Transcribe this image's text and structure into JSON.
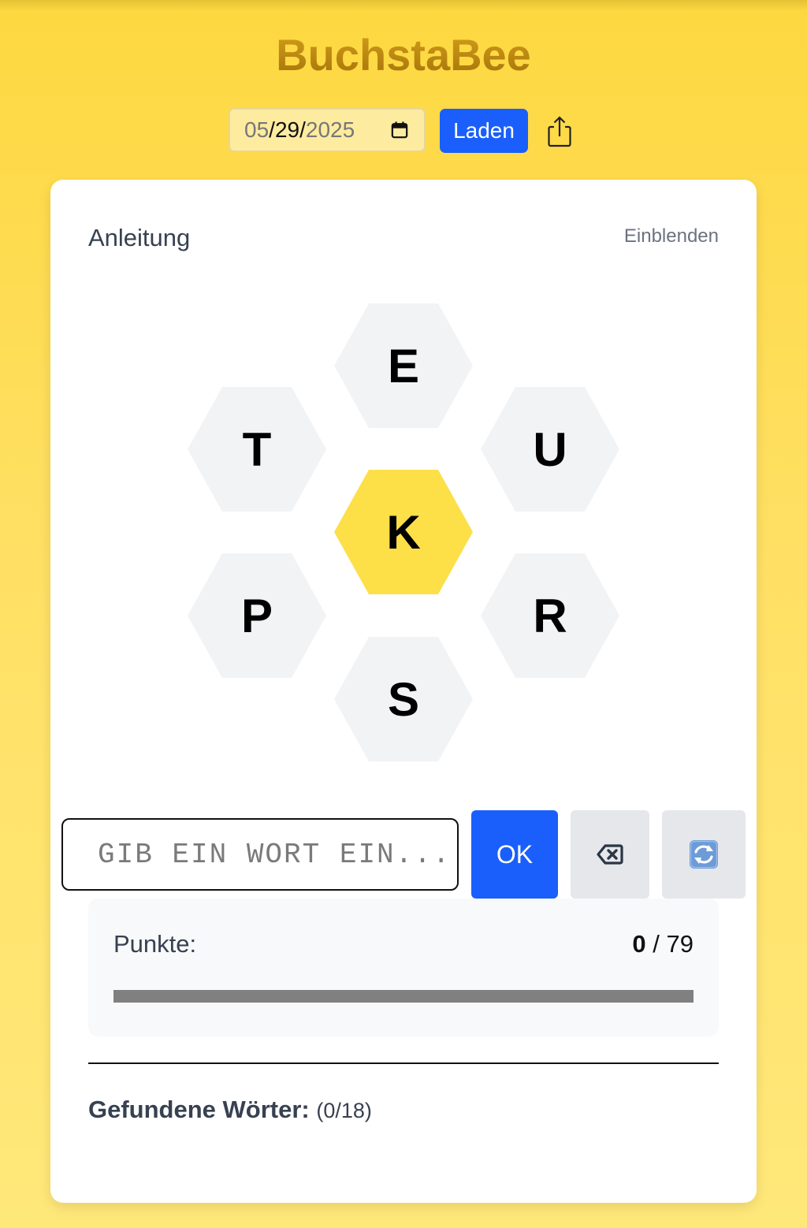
{
  "app": {
    "title": "BuchstaBee"
  },
  "date_picker": {
    "month": "05",
    "day": "29",
    "year": "2025",
    "separator": "/",
    "icon": "calendar-icon"
  },
  "load_button": {
    "label": "Laden"
  },
  "share_button": {
    "icon": "share-icon"
  },
  "instructions": {
    "title": "Anleitung",
    "toggle_label": "Einblenden"
  },
  "hive": {
    "center_letter": "K",
    "outer_letters": {
      "top": "E",
      "upper_left": "T",
      "upper_right": "U",
      "lower_left": "P",
      "lower_right": "R",
      "bottom": "S"
    },
    "center_color": "#fddf48",
    "outer_color": "#f2f3f5"
  },
  "word_entry": {
    "value": "",
    "placeholder": "GIB EIN WORT EIN...",
    "ok_label": "OK",
    "delete_icon": "backspace-icon",
    "shuffle_icon": "shuffle-icon"
  },
  "score": {
    "label": "Punkte:",
    "current": "0",
    "separator": " / ",
    "max": "79",
    "progress_fraction": 0
  },
  "found_words": {
    "label": "Gefundene Wörter:",
    "count_text": "(0/18)",
    "items": []
  },
  "colors": {
    "accent": "#1a5ffb",
    "title_gold": "#b07d10",
    "background_yellow": "#fdd840"
  }
}
